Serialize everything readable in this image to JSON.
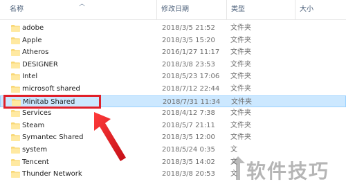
{
  "columns": {
    "name": "名称",
    "date": "修改日期",
    "type": "类型",
    "size": "大小"
  },
  "rows": [
    {
      "name": "adobe",
      "date": "2018/3/5 21:52",
      "type": "文件夹"
    },
    {
      "name": "Apple",
      "date": "2018/3/5 15:20",
      "type": "文件夹"
    },
    {
      "name": "Atheros",
      "date": "2016/1/27 11:17",
      "type": "文件夹"
    },
    {
      "name": "DESIGNER",
      "date": "2018/3/8 23:53",
      "type": "文件夹"
    },
    {
      "name": "Intel",
      "date": "2018/5/23 17:06",
      "type": "文件夹"
    },
    {
      "name": "microsoft shared",
      "date": "2018/7/12 22:44",
      "type": "文件夹"
    },
    {
      "name": "Minitab Shared",
      "date": "2018/7/31 11:34",
      "type": "文件夹",
      "selected": true
    },
    {
      "name": "Services",
      "date": "2018/4/12 7:38",
      "type": "文件夹"
    },
    {
      "name": "Steam",
      "date": "2018/5/7 21:11",
      "type": "文件夹"
    },
    {
      "name": "Symantec Shared",
      "date": "2018/3/5 12:00",
      "type": "文件夹"
    },
    {
      "name": "system",
      "date": "2018/5/24 0:35",
      "type": "文"
    },
    {
      "name": "Tencent",
      "date": "2018/3/5 14:02",
      "type": "文"
    },
    {
      "name": "Thunder Network",
      "date": "2018/3/8 20:53",
      "type": "文"
    }
  ],
  "watermark": {
    "text": "软件技巧"
  },
  "colors": {
    "selection_bg": "#cce8ff",
    "selection_border": "#99d1ff",
    "annotation_red": "#e0202a",
    "folder_yellow": "#f8d775"
  }
}
